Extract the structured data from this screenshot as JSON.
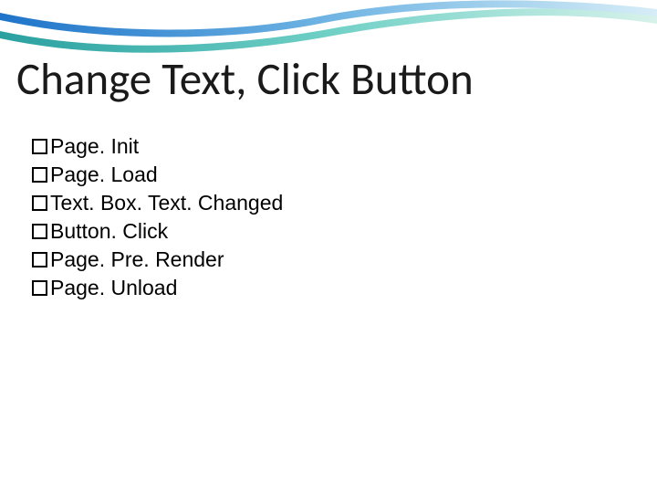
{
  "slide": {
    "title": "Change Text, Click Button",
    "bullets": [
      "Page. Init",
      "Page. Load",
      "Text. Box. Text. Changed",
      "Button. Click",
      "Page. Pre. Render",
      "Page. Unload"
    ]
  }
}
